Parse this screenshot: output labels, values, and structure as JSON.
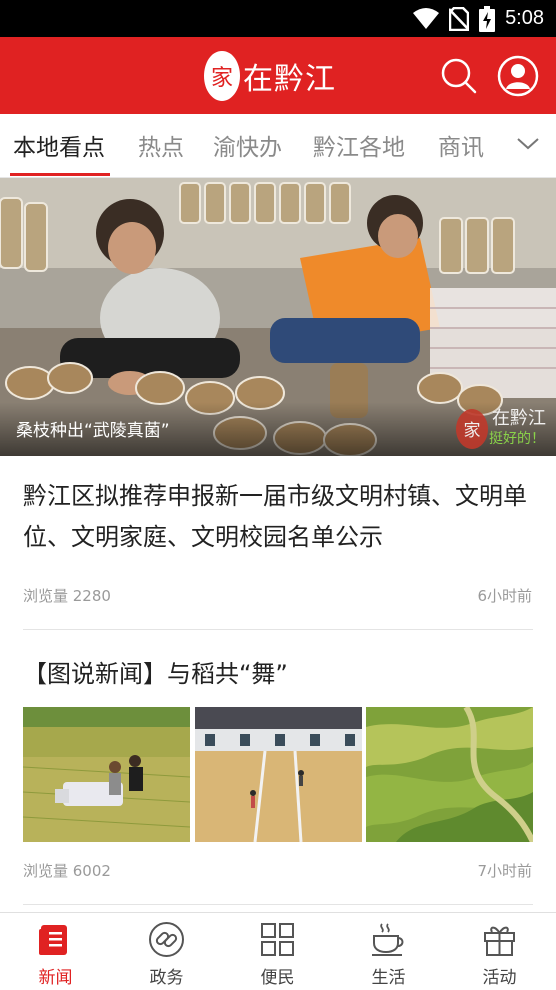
{
  "status_bar": {
    "time": "5:08"
  },
  "header": {
    "app_name": "在黔江",
    "logo_glyph": "家",
    "search_icon": "search-icon",
    "user_icon": "user-icon",
    "brand_color": "#e02222"
  },
  "tabs": [
    {
      "label": "本地看点",
      "active": true
    },
    {
      "label": "热点",
      "active": false
    },
    {
      "label": "渝快办",
      "active": false
    },
    {
      "label": "黔江各地",
      "active": false
    },
    {
      "label": "商讯",
      "active": false
    }
  ],
  "hero": {
    "caption": "桑枝种出“武陵真菌”",
    "watermark_glyph": "家",
    "watermark_text": "在黔江",
    "watermark_sub": "挺好的！"
  },
  "articles": [
    {
      "title": "黔江区拟推荐申报新一届市级文明村镇、文明单位、文明家庭、文明校园名单公示",
      "views": "浏览量 2280",
      "time": "6小时前"
    },
    {
      "title": "【图说新闻】与稻共“舞”",
      "views": "浏览量 6002",
      "time": "7小时前"
    }
  ],
  "bottom_nav": [
    {
      "label": "新闻",
      "icon": "news-icon",
      "active": true
    },
    {
      "label": "政务",
      "icon": "link-icon",
      "active": false
    },
    {
      "label": "便民",
      "icon": "grid-icon",
      "active": false
    },
    {
      "label": "生活",
      "icon": "coffee-icon",
      "active": false
    },
    {
      "label": "活动",
      "icon": "gift-icon",
      "active": false
    }
  ]
}
